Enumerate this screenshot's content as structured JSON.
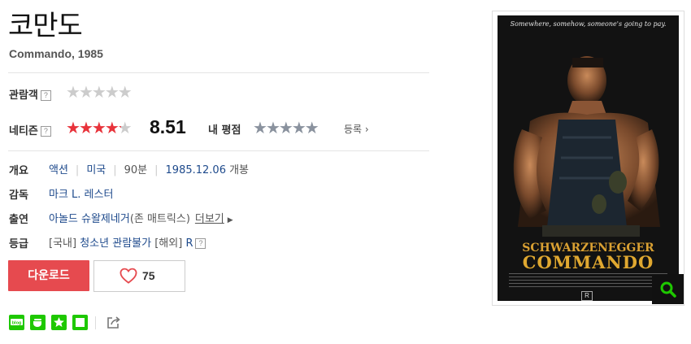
{
  "title": "코만도",
  "subtitle": "Commando, 1985",
  "ratings": {
    "audience_label": "관람객",
    "audience_stars": 0,
    "netizen_label": "네티즌",
    "netizen_stars": 4.25,
    "netizen_score": "8.51",
    "my_rating_label": "내 평점",
    "my_stars": 0,
    "register_label": "등록"
  },
  "info": {
    "overview_label": "개요",
    "genre": "액션",
    "country": "미국",
    "runtime": "90분",
    "release_date": "1985.12.06",
    "release_suffix": " 개봉",
    "director_label": "감독",
    "director": "마크 L. 레스터",
    "cast_label": "출연",
    "cast": "아놀드 슈왈제네거",
    "cast_role": "(존 매트릭스)",
    "more_label": "더보기",
    "rating_label": "등급",
    "rating_domestic_tag": "[국내]",
    "rating_domestic": "청소년 관람불가",
    "rating_overseas_tag": "[해외]",
    "rating_overseas": "R"
  },
  "actions": {
    "download_label": "다운로드",
    "like_count": "75"
  },
  "share": {
    "icons": [
      "blog-icon",
      "cafe-icon",
      "bookmark-icon",
      "memo-icon",
      "share-icon"
    ],
    "blog_text": "blog"
  },
  "poster": {
    "tagline": "Somewhere, somehow, someone's going to pay.",
    "actor": "SCHWARZENEGGER",
    "film": "COMMANDO",
    "rating_mark": "R"
  },
  "colors": {
    "accent_red": "#e64a4f",
    "link_blue": "#1e4a8c",
    "share_green": "#1ec800"
  }
}
